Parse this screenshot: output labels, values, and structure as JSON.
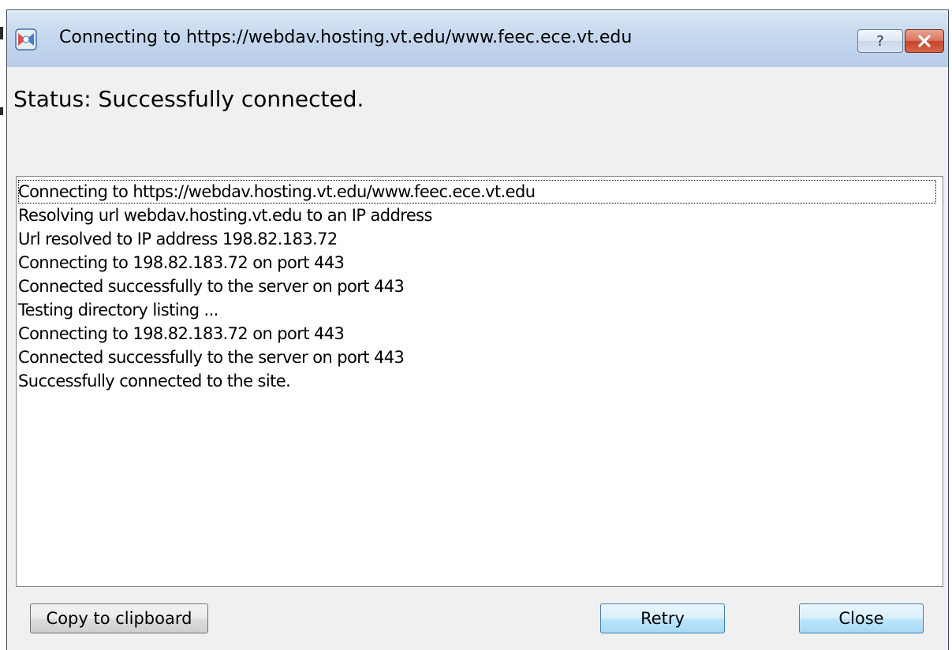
{
  "window": {
    "title": "Connecting to https://webdav.hosting.vt.edu/www.feec.ece.vt.edu",
    "icon": "app-globe-icon",
    "help_glyph": "?",
    "close_glyph": "✕"
  },
  "status": {
    "text": "Status: Successfully connected."
  },
  "log": {
    "lines": [
      "Connecting to https://webdav.hosting.vt.edu/www.feec.ece.vt.edu",
      "Resolving url webdav.hosting.vt.edu to an IP address",
      "Url resolved to IP address 198.82.183.72",
      "Connecting to 198.82.183.72 on port 443",
      "Connected successfully to the server on port 443",
      "Testing directory listing ...",
      "Connecting to 198.82.183.72 on port 443",
      "Connected successfully to the server on port 443",
      "Successfully connected to the site."
    ]
  },
  "buttons": {
    "copy_label": "Copy to clipboard",
    "retry_label": "Retry",
    "close_label": "Close"
  },
  "colors": {
    "titlebar": "#c6d8ee",
    "close_button": "#c8462a",
    "default_button_border": "#3c7fb1"
  }
}
